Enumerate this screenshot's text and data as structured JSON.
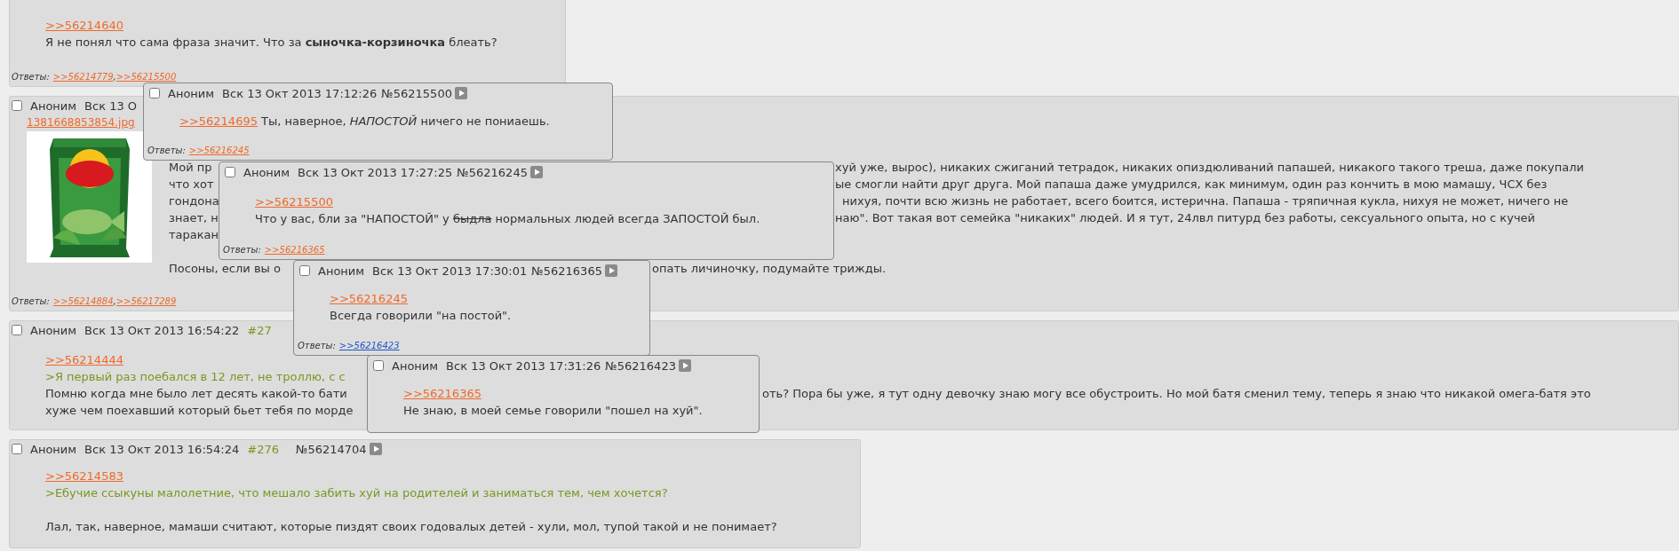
{
  "posts": [
    {
      "quote_link": ">>56214640",
      "lines": [
        {
          "kind": "plain",
          "left": "Я не понял что сама фраза значит. Что за **сыночка-корзиночка** блеать?"
        }
      ],
      "replies_label": "Ответы:",
      "reply_separator": ",",
      "replies": [
        {
          "text": ">>56214779",
          "visited": false
        },
        {
          "text": ">>56215500",
          "visited": false
        }
      ]
    },
    {
      "checked": false,
      "name": "Аноним",
      "date": "Вск 13 О",
      "file": "1381668853854.jpg",
      "image": {
        "kind": "picture"
      },
      "lines": [
        {
          "kind": "plain",
          "left": "Мой пр",
          "right": "хуй уже, вырос), никаких сжиганий тетрадок, никаких опиздюливаний папашей, никакого такого треша, даже покупали"
        },
        {
          "kind": "plain",
          "left": "что хот",
          "right": "ые смогли найти друг друга. Мой папаша даже умудрился, как минимум, один раз кончить в мою мамашу, ЧСХ без"
        },
        {
          "kind": "plain",
          "left": "гондона",
          "right": "нихуя, почти всю жизнь не работает, всего боится, истерична. Папаша - тряпичная кукла, нихуя не может, ничего не"
        },
        {
          "kind": "plain",
          "left": "знает, н",
          "right": "наю\". Вот такая вот семейка \"никаких\" людей. И я тут, 24лвл питурд без работы, сексуального опыта, но с кучей"
        },
        {
          "kind": "plain",
          "left": "таракан"
        },
        {
          "kind": "plain",
          "left": "Посоны, если вы о",
          "right": "опать личиночку, подумайте трижды.",
          "break_before": true
        }
      ],
      "replies_label": "Ответы:",
      "reply_separator": ",",
      "replies": [
        {
          "text": ">>56214884",
          "visited": false
        },
        {
          "text": ">>56217289",
          "visited": false
        }
      ]
    },
    {
      "checked": false,
      "name": "Аноним",
      "date": "Вск 13 Окт 2013 16:54:22",
      "number": "#27",
      "quote_link": ">>56214444",
      "lines": [
        {
          "kind": "green",
          "left": ">Я первый раз поебался в 12 лет, не троллю, с с"
        },
        {
          "kind": "plain",
          "left": "Помню когда мне было лет десять какой-то бати",
          "right": "оть? Пора бы уже, я тут одну девочку знаю могу все обустроить. Но мой батя сменил тему, теперь я знаю что никакой омега-батя это"
        },
        {
          "kind": "plain",
          "left": "хуже чем поехавший который бьет тебя по морде"
        }
      ]
    },
    {
      "checked": false,
      "name": "Аноним",
      "date": "Вск 13 Окт 2013 16:54:24",
      "number": "#276",
      "post_no": "№56214704",
      "quote_link": ">>56214583",
      "lines": [
        {
          "kind": "green",
          "left": ">Ебучие ссыкуны малолетние, что мешало забить хуй на родителей и заниматься тем, чем хочется?"
        },
        {
          "kind": "plain",
          "left": "Лал, так, наверное, мамаши считают, которые пиздят своих годовалых детей - хули, мол, тупой такой и не понимает?",
          "break_before": true
        }
      ]
    }
  ],
  "popups": [
    {
      "checked": false,
      "name": "Аноним",
      "date": "Вск 13 Окт 2013 17:12:26",
      "post_no": "№56215500",
      "quote_link": ">>56214695",
      "quote_inline": true,
      "text": "Ты, наверное, *НАПОСТОЙ* ничего не пониаешь.",
      "replies_label": "Ответы:",
      "replies": [
        {
          "text": ">>56216245",
          "visited": false
        }
      ]
    },
    {
      "checked": false,
      "name": "Аноним",
      "date": "Вск 13 Окт 2013 17:27:25",
      "post_no": "№56216245",
      "quote_link": ">>56215500",
      "quote_inline": false,
      "text": [
        {
          "text": "Что у вас, бли за \"НАПОСТОЙ\" у ",
          "struck": false
        },
        {
          "text": "быдла",
          "struck": true
        },
        {
          "text": " нормальных людей всегда ЗАПОСТОЙ был.",
          "struck": false
        }
      ],
      "replies_label": "Ответы:",
      "replies": [
        {
          "text": ">>56216365",
          "visited": false
        }
      ]
    },
    {
      "checked": false,
      "name": "Аноним",
      "date": "Вск 13 Окт 2013 17:30:01",
      "post_no": "№56216365",
      "quote_link": ">>56216245",
      "quote_inline": false,
      "text": "Всегда говорили \"на постой\".",
      "replies_label": "Ответы:",
      "replies": [
        {
          "text": ">>56216423",
          "visited": true
        }
      ]
    },
    {
      "checked": false,
      "name": "Аноним",
      "date": "Вск 13 Окт 2013 17:31:26",
      "post_no": "№56216423",
      "quote_link": ">>56216365",
      "quote_inline": false,
      "text": "Не знаю, в моей семье говорили \"пошел на хуй\"."
    }
  ]
}
